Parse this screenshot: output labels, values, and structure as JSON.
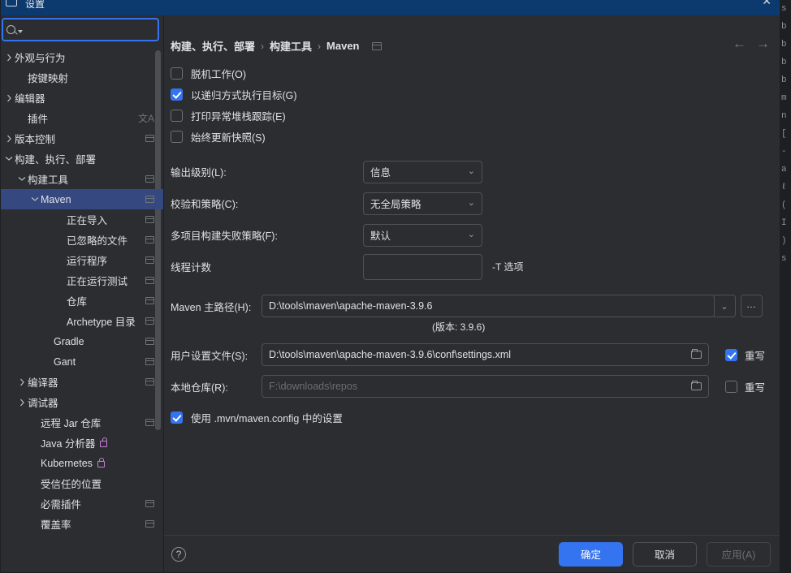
{
  "window": {
    "title": "设置",
    "close_label": "✕"
  },
  "search": {
    "value": "",
    "placeholder": ""
  },
  "sidebar": {
    "items": [
      {
        "label": "外观与行为",
        "indent": 0,
        "arrow": "right",
        "badge": false,
        "selected": false
      },
      {
        "label": "按键映射",
        "indent": 1,
        "arrow": "none",
        "badge": false,
        "selected": false
      },
      {
        "label": "编辑器",
        "indent": 0,
        "arrow": "right",
        "badge": false,
        "selected": false
      },
      {
        "label": "插件",
        "indent": 1,
        "arrow": "none",
        "badge": false,
        "translate": true,
        "selected": false
      },
      {
        "label": "版本控制",
        "indent": 0,
        "arrow": "right",
        "badge": true,
        "selected": false
      },
      {
        "label": "构建、执行、部署",
        "indent": 0,
        "arrow": "down",
        "badge": false,
        "selected": false
      },
      {
        "label": "构建工具",
        "indent": 1,
        "arrow": "down",
        "badge": true,
        "selected": false
      },
      {
        "label": "Maven",
        "indent": 2,
        "arrow": "down",
        "badge": true,
        "selected": true
      },
      {
        "label": "正在导入",
        "indent": 4,
        "arrow": "none",
        "badge": true,
        "selected": false
      },
      {
        "label": "已忽略的文件",
        "indent": 4,
        "arrow": "none",
        "badge": true,
        "selected": false
      },
      {
        "label": "运行程序",
        "indent": 4,
        "arrow": "none",
        "badge": true,
        "selected": false
      },
      {
        "label": "正在运行测试",
        "indent": 4,
        "arrow": "none",
        "badge": true,
        "selected": false
      },
      {
        "label": "仓库",
        "indent": 4,
        "arrow": "none",
        "badge": true,
        "selected": false
      },
      {
        "label": "Archetype 目录",
        "indent": 4,
        "arrow": "none",
        "badge": true,
        "selected": false
      },
      {
        "label": "Gradle",
        "indent": 3,
        "arrow": "none",
        "badge": true,
        "selected": false
      },
      {
        "label": "Gant",
        "indent": 3,
        "arrow": "none",
        "badge": true,
        "selected": false
      },
      {
        "label": "编译器",
        "indent": 1,
        "arrow": "right",
        "badge": true,
        "selected": false
      },
      {
        "label": "调试器",
        "indent": 1,
        "arrow": "right",
        "badge": false,
        "selected": false
      },
      {
        "label": "远程 Jar 仓库",
        "indent": 2,
        "arrow": "none",
        "badge": true,
        "selected": false
      },
      {
        "label": "Java 分析器",
        "indent": 2,
        "arrow": "none",
        "badge": false,
        "lock": true,
        "selected": false
      },
      {
        "label": "Kubernetes",
        "indent": 2,
        "arrow": "none",
        "badge": false,
        "lock": true,
        "selected": false
      },
      {
        "label": "受信任的位置",
        "indent": 2,
        "arrow": "none",
        "badge": false,
        "selected": false
      },
      {
        "label": "必需插件",
        "indent": 2,
        "arrow": "none",
        "badge": true,
        "selected": false
      },
      {
        "label": "覆盖率",
        "indent": 2,
        "arrow": "none",
        "badge": true,
        "selected": false
      }
    ]
  },
  "breadcrumb": {
    "items": [
      "构建、执行、部署",
      "构建工具",
      "Maven"
    ],
    "separator": "›"
  },
  "nav": {
    "back": "←",
    "forward": "→"
  },
  "main": {
    "checkboxes": [
      {
        "label": "脱机工作(O)",
        "checked": false
      },
      {
        "label": "以递归方式执行目标(G)",
        "checked": true
      },
      {
        "label": "打印异常堆栈跟踪(E)",
        "checked": false
      },
      {
        "label": "始终更新快照(S)",
        "checked": false
      }
    ],
    "selects": [
      {
        "label": "输出级别(L):",
        "value": "信息"
      },
      {
        "label": "校验和策略(C):",
        "value": "无全局策略"
      },
      {
        "label": "多项目构建失败策略(F):",
        "value": "默认"
      }
    ],
    "thread_count": {
      "label": "线程计数",
      "value": "",
      "hint": "-T 选项"
    },
    "maven_home": {
      "label": "Maven 主路径(H):",
      "value": "D:\\tools\\maven\\apache-maven-3.9.6",
      "ellipsis": "…",
      "version_note": "(版本: 3.9.6)"
    },
    "user_settings": {
      "label": "用户设置文件(S):",
      "value": "D:\\tools\\maven\\apache-maven-3.9.6\\conf\\settings.xml",
      "override_label": "重写",
      "override_checked": true
    },
    "local_repo": {
      "label": "本地仓库(R):",
      "value": "F:\\downloads\\repos",
      "is_placeholder": true,
      "override_label": "重写",
      "override_checked": false
    },
    "mvn_config": {
      "label": "使用 .mvn/maven.config 中的设置",
      "checked": true
    }
  },
  "footer": {
    "help": "?",
    "ok": "确定",
    "cancel": "取消",
    "apply": "应用(A)"
  },
  "background_editor": {
    "lines": [
      "s",
      "b",
      "b",
      "b",
      "b",
      "m",
      "",
      "",
      "",
      "n",
      "[",
      "-",
      "a",
      "",
      "",
      "",
      "",
      "",
      "",
      "ℓ",
      "(",
      "I",
      ")",
      "s"
    ]
  },
  "colors": {
    "accent": "#3574f0",
    "selection": "#364880",
    "bg": "#2b2d30",
    "border": "#4e5157",
    "text": "#dfe1e5"
  }
}
